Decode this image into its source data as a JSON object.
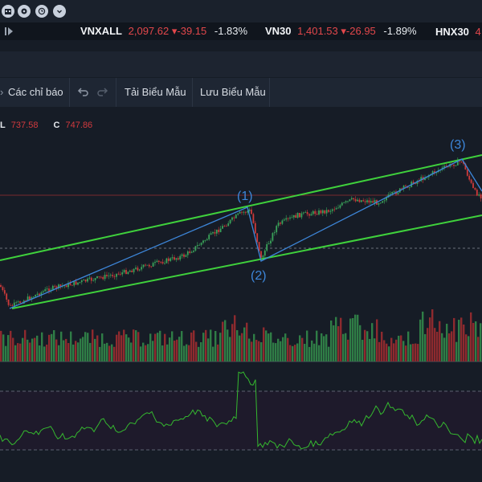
{
  "toolbar_top": {
    "icons": [
      "calendar-icon",
      "gauge-icon",
      "clock-icon",
      "chevron-down-icon"
    ]
  },
  "ticker": [
    {
      "name": "VNXALL",
      "price": "2,097.62",
      "change": "-39.15",
      "pct": "-1.83%"
    },
    {
      "name": "VN30",
      "price": "1,401.53",
      "change": "-26.95",
      "pct": "-1.89%"
    },
    {
      "name": "HNX30",
      "price": "4"
    }
  ],
  "toolbar": {
    "indicators_label": "Các chỉ báo",
    "load_template_label": "Tải Biểu Mẫu",
    "save_template_label": "Lưu Biểu Mẫu"
  },
  "ohlc": {
    "low_label": "L",
    "low_value": "737.58",
    "close_label": "C",
    "close_value": "747.86"
  },
  "waves": {
    "w1": "(1)",
    "w2": "(2)",
    "w3": "(3)"
  },
  "colors": {
    "up": "#3aa35a",
    "down": "#cf3a3a",
    "channel": "#3fd13c",
    "wave_line": "#3d86d9",
    "rsi_line": "#35b82f"
  }
}
